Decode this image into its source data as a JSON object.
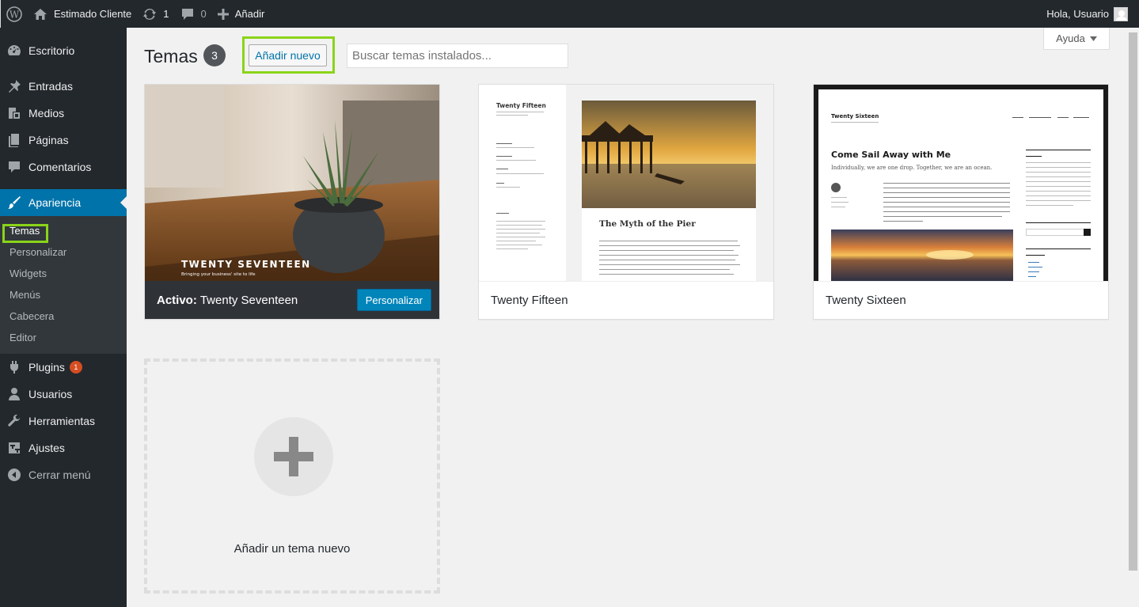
{
  "adminbar": {
    "site": "Estimado Cliente",
    "updates": "1",
    "comments": "0",
    "add": "Añadir",
    "greeting": "Hola, Usuario"
  },
  "menu": {
    "items": [
      {
        "label": "Escritorio",
        "icon": "dashboard-icon"
      },
      {
        "label": "Entradas",
        "icon": "pin-icon"
      },
      {
        "label": "Medios",
        "icon": "media-icon"
      },
      {
        "label": "Páginas",
        "icon": "page-icon"
      },
      {
        "label": "Comentarios",
        "icon": "comment-icon"
      },
      {
        "label": "Apariencia",
        "icon": "brush-icon"
      },
      {
        "label": "Plugins",
        "icon": "plugin-icon",
        "badge": "1"
      },
      {
        "label": "Usuarios",
        "icon": "user-icon"
      },
      {
        "label": "Herramientas",
        "icon": "wrench-icon"
      },
      {
        "label": "Ajustes",
        "icon": "settings-icon"
      },
      {
        "label": "Cerrar menú",
        "icon": "collapse-icon"
      }
    ],
    "submenu": [
      "Temas",
      "Personalizar",
      "Widgets",
      "Menús",
      "Cabecera",
      "Editor"
    ]
  },
  "page": {
    "title": "Temas",
    "count": "3",
    "add_new": "Añadir nuevo",
    "search_placeholder": "Buscar temas instalados...",
    "help": "Ayuda"
  },
  "themes": [
    {
      "name": "Twenty Seventeen",
      "active_label": "Activo:",
      "customize": "Personalizar",
      "shot_title": "TWENTY SEVENTEEN",
      "shot_tagline": "Bringing your business' site to life"
    },
    {
      "name": "Twenty Fifteen",
      "shot_title": "Twenty Fifteen",
      "shot_post": "The Myth of the Pier"
    },
    {
      "name": "Twenty Sixteen",
      "shot_title": "Twenty Sixteen",
      "shot_post": "Come Sail Away with Me",
      "shot_sub": "Individually, we are one drop. Together, we are an ocean."
    }
  ],
  "add_theme": "Añadir un tema nuevo",
  "colors": {
    "adminbar": "#23282d",
    "accent": "#0073aa",
    "highlight": "#8ad419",
    "badge": "#d54e21"
  }
}
